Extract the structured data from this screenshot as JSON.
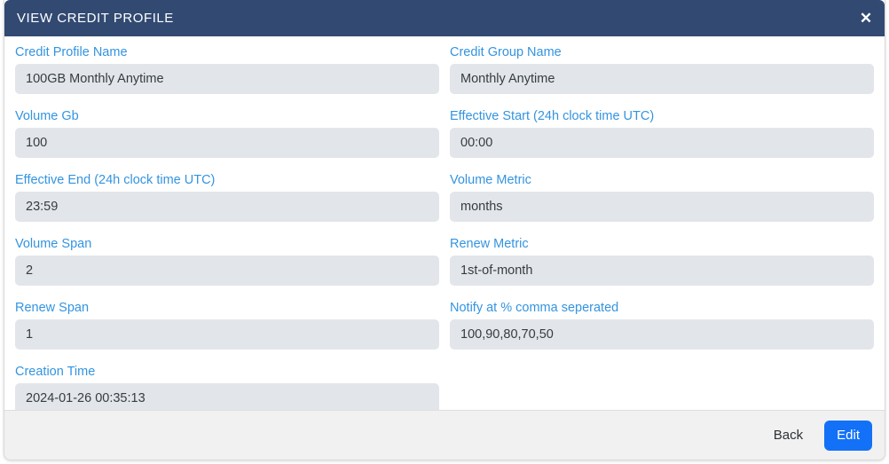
{
  "dialog": {
    "title": "VIEW CREDIT PROFILE",
    "close_icon": "close-icon",
    "header_color": "#324a72",
    "accent_color": "#1271f7",
    "label_color": "#3394e0",
    "field_bg_color": "#e2e6ea"
  },
  "fields": [
    {
      "label": "Credit Profile Name",
      "value": "100GB Monthly Anytime"
    },
    {
      "label": "Credit Group Name",
      "value": "Monthly Anytime"
    },
    {
      "label": "Volume Gb",
      "value": "100"
    },
    {
      "label": "Effective Start (24h clock time UTC)",
      "value": "00:00"
    },
    {
      "label": "Effective End (24h clock time UTC)",
      "value": "23:59"
    },
    {
      "label": "Volume Metric",
      "value": "months"
    },
    {
      "label": "Volume Span",
      "value": "2"
    },
    {
      "label": "Renew Metric",
      "value": "1st-of-month"
    },
    {
      "label": "Renew Span",
      "value": "1"
    },
    {
      "label": "Notify at % comma seperated",
      "value": "100,90,80,70,50"
    },
    {
      "label": "Creation Time",
      "value": "2024-01-26 00:35:13"
    }
  ],
  "footer": {
    "back_label": "Back",
    "edit_label": "Edit"
  }
}
